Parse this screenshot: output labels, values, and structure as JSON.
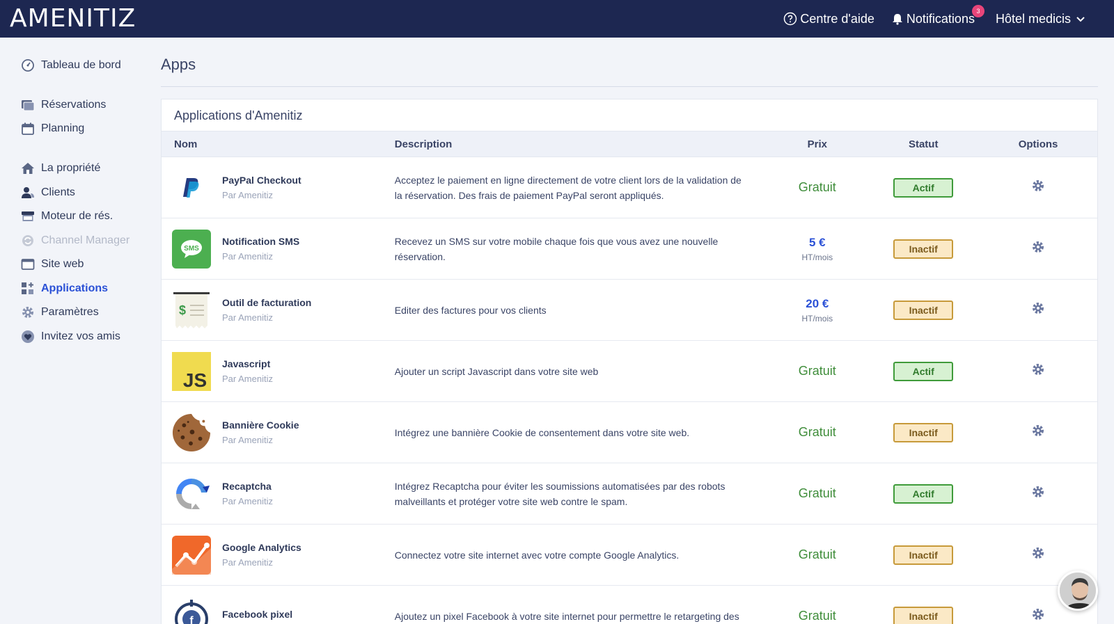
{
  "brand": {
    "logo": "AMENITIZ"
  },
  "topbar": {
    "help_label": "Centre d'aide",
    "notifications_label": "Notifications",
    "notifications_count": "3",
    "hotel_label": "Hôtel medicis"
  },
  "sidebar": {
    "items": [
      {
        "label": "Tableau de bord",
        "icon": "gauge-icon"
      },
      {
        "label": "Réservations",
        "icon": "calendar-stack-icon"
      },
      {
        "label": "Planning",
        "icon": "calendar-icon"
      },
      {
        "label": "La propriété",
        "icon": "home-icon"
      },
      {
        "label": "Clients",
        "icon": "users-icon"
      },
      {
        "label": "Moteur de rés.",
        "icon": "shop-icon"
      },
      {
        "label": "Channel Manager",
        "icon": "sync-icon",
        "disabled": true
      },
      {
        "label": "Site web",
        "icon": "browser-icon"
      },
      {
        "label": "Applications",
        "icon": "apps-icon",
        "active": true
      },
      {
        "label": "Paramètres",
        "icon": "gear-icon"
      },
      {
        "label": "Invitez vos amis",
        "icon": "heart-icon"
      }
    ]
  },
  "page": {
    "title": "Apps"
  },
  "apps_card": {
    "title": "Applications d'Amenitiz",
    "columns": {
      "name": "Nom",
      "description": "Description",
      "price": "Prix",
      "status": "Statut",
      "options": "Options"
    },
    "rows": [
      {
        "name": "PayPal Checkout",
        "by": "Par Amenitiz",
        "description": "Acceptez le paiement en ligne directement de votre client lors de la validation de la réservation. Des frais de paiement PayPal seront appliqués.",
        "price": "Gratuit",
        "status": "Actif",
        "logo": "paypal-logo"
      },
      {
        "name": "Notification SMS",
        "by": "Par Amenitiz",
        "description": "Recevez un SMS sur votre mobile chaque fois que vous avez une nouvelle réservation.",
        "price": "5 €",
        "price_unit": "HT/mois",
        "status": "Inactif",
        "logo": "sms-logo"
      },
      {
        "name": "Outil de facturation",
        "by": "Par Amenitiz",
        "description": "Editer des factures pour vos clients",
        "price": "20 €",
        "price_unit": "HT/mois",
        "status": "Inactif",
        "logo": "invoice-logo"
      },
      {
        "name": "Javascript",
        "by": "Par Amenitiz",
        "description": "Ajouter un script Javascript dans votre site web",
        "price": "Gratuit",
        "status": "Actif",
        "logo": "javascript-logo"
      },
      {
        "name": "Bannière Cookie",
        "by": "Par Amenitiz",
        "description": "Intégrez une bannière Cookie de consentement dans votre site web.",
        "price": "Gratuit",
        "status": "Inactif",
        "logo": "cookie-logo"
      },
      {
        "name": "Recaptcha",
        "by": "Par Amenitiz",
        "description": "Intégrez Recaptcha pour éviter les soumissions automatisées par des robots malveillants et protéger votre site web contre le spam.",
        "price": "Gratuit",
        "status": "Actif",
        "logo": "recaptcha-logo"
      },
      {
        "name": "Google Analytics",
        "by": "Par Amenitiz",
        "description": "Connectez votre site internet avec votre compte Google Analytics.",
        "price": "Gratuit",
        "status": "Inactif",
        "logo": "analytics-logo"
      },
      {
        "name": "Facebook pixel",
        "by": "",
        "description": "Ajoutez un pixel Facebook à votre site internet pour permettre le retargeting des",
        "price": "Gratuit",
        "status": "Inactif",
        "logo": "facebook-pixel-logo"
      }
    ]
  }
}
